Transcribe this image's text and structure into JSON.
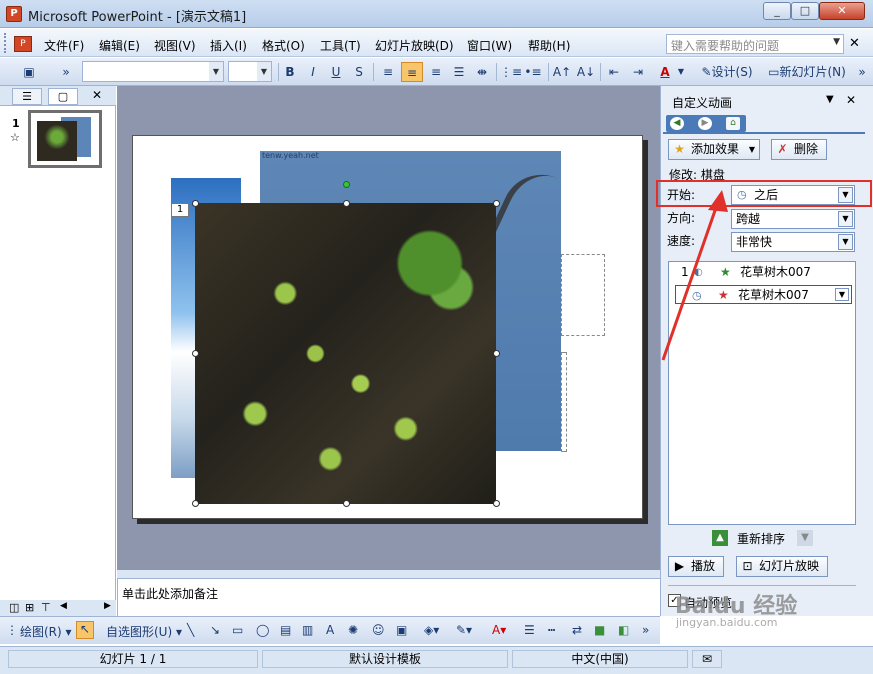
{
  "window": {
    "title": "Microsoft PowerPoint - [演示文稿1]",
    "app_icon": "P",
    "buttons": [
      "_",
      "□",
      "✕"
    ]
  },
  "menu": {
    "items": [
      "文件(F)",
      "编辑(E)",
      "视图(V)",
      "插入(I)",
      "格式(O)",
      "工具(T)",
      "幻灯片放映(D)",
      "窗口(W)",
      "帮助(H)"
    ],
    "help_placeholder": "键入需要帮助的问题",
    "close": "✕"
  },
  "toolbar": {
    "bold": "B",
    "italic": "I",
    "underline": "U",
    "shadow": "S",
    "font_color": "A",
    "design_label": "设计(S)",
    "new_slide_label": "新幻灯片(N)"
  },
  "left_pane": {
    "tab_outline": "☰",
    "tab_slides": "▢",
    "close": "✕",
    "slide_number": "1",
    "slide_star": "☆"
  },
  "slide": {
    "url_text": "tenw.yeah.net",
    "anim_tag": "1"
  },
  "notes": {
    "placeholder": "单击此处添加备注"
  },
  "task_pane": {
    "title": "自定义动画",
    "add_effect": "添加效果",
    "remove": "删除",
    "modify_label": "修改: 棋盘",
    "start_label": "开始:",
    "start_value": "之后",
    "direction_label": "方向:",
    "direction_value": "跨越",
    "speed_label": "速度:",
    "speed_value": "非常快",
    "items": [
      {
        "index": "1",
        "name": "花草树木007"
      },
      {
        "index": "",
        "name": "花草树木007"
      }
    ],
    "reorder_label": "重新排序",
    "play_label": "播放",
    "slideshow_label": "幻灯片放映",
    "autopreview_label": "自动预览"
  },
  "draw_toolbar": {
    "draw_label": "绘图(R)",
    "autoshapes_label": "自选图形(U)"
  },
  "status": {
    "slide": "幻灯片 1 / 1",
    "template": "默认设计模板",
    "language": "中文(中国)"
  },
  "watermark": {
    "brand": "Baidu 经验",
    "url": "jingyan.baidu.com"
  },
  "colors": {
    "highlight": "#e0302a",
    "slide_bg": "#8e96ad"
  }
}
